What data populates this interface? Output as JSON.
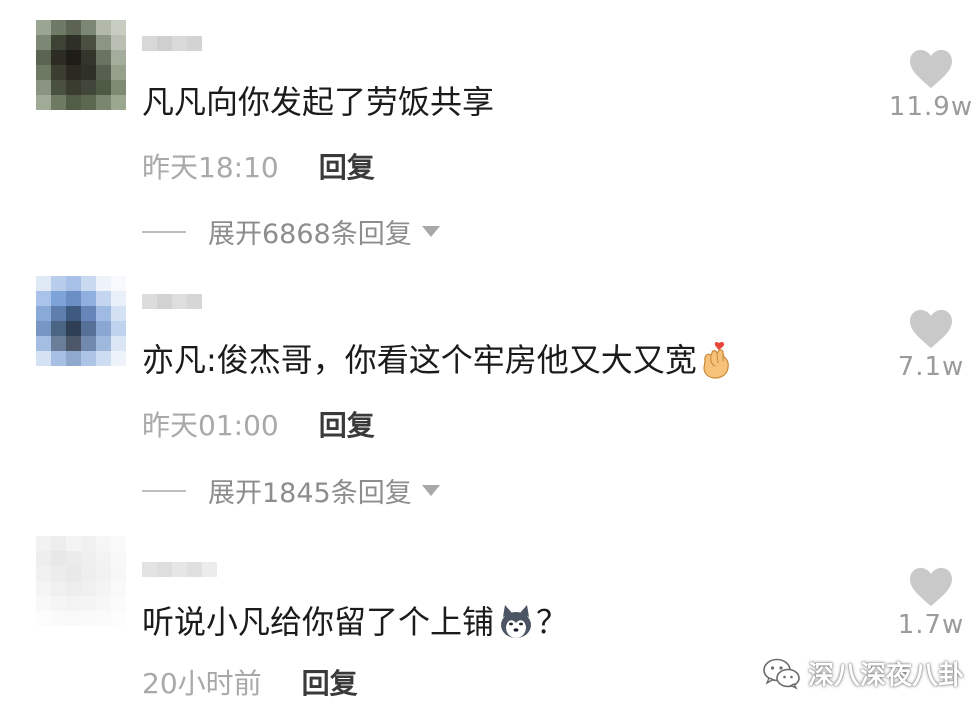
{
  "comments": [
    {
      "text": "凡凡向你发起了劳饭共享",
      "time": "昨天18:10",
      "reply_label": "回复",
      "expand_label": "展开6868条回复",
      "likes": "11.9w",
      "avatar_colors": [
        "#9aa592",
        "#6f7a66",
        "#5c6352",
        "#7b8673",
        "#b2b9aa",
        "#c8cdc2",
        "#7d8874",
        "#3c4234",
        "#2e2f27",
        "#4a5040",
        "#8c9584",
        "#b9bfb2",
        "#5a6450",
        "#2d2c24",
        "#1e1d18",
        "#34362b",
        "#6a7260",
        "#a4ac9b",
        "#6e7964",
        "#3b3d30",
        "#2a2a22",
        "#2f3128",
        "#576050",
        "#96a08b",
        "#8a9480",
        "#495040",
        "#3a3c30",
        "#41463a",
        "#4f5a45",
        "#7e8a72",
        "#a0aa96",
        "#6e7a62",
        "#525d47",
        "#5c6850",
        "#7a8670",
        "#9ca790"
      ]
    },
    {
      "text": "亦凡:俊杰哥，你看这个牢房他又大又宽",
      "emoji": "finger-heart-emoji",
      "time": "昨天01:00",
      "reply_label": "回复",
      "expand_label": "展开1845条回复",
      "likes": "7.1w",
      "avatar_colors": [
        "#dfe8f5",
        "#b8cdec",
        "#a6c0e8",
        "#c9d9f0",
        "#eef3fa",
        "#f7f9fc",
        "#a9c3ea",
        "#7ea3d8",
        "#6b8fc4",
        "#8fb0df",
        "#c4d6ef",
        "#e9f0f9",
        "#89a9d8",
        "#5e7fae",
        "#3e5a80",
        "#6685b8",
        "#9fbbe3",
        "#d4e1f3",
        "#7896c4",
        "#4a6484",
        "#2f3f56",
        "#556f96",
        "#8aa6d2",
        "#c0d3ee",
        "#a4bde2",
        "#6a7e9a",
        "#4c586a",
        "#7189ae",
        "#9fb8de",
        "#dbe6f5",
        "#d5e2f4",
        "#a7bfe2",
        "#8ea8ce",
        "#aec4e6",
        "#cddcf1",
        "#eef3fa"
      ]
    },
    {
      "text": "听说小凡给你留了个上铺",
      "emoji": "husky-emoji",
      "text_after": "？",
      "time": "20小时前",
      "reply_label": "回复",
      "likes": "1.7w",
      "avatar_colors": [
        "#f2f2f2",
        "#ededed",
        "#f4f4f4",
        "#f0f0f0",
        "#f6f6f6",
        "#fafafa",
        "#eeeeee",
        "#e8e8e8",
        "#ebebeb",
        "#efefef",
        "#f3f3f3",
        "#f8f8f8",
        "#f1f1f1",
        "#ececec",
        "#e9e9e9",
        "#eeeeee",
        "#f2f2f2",
        "#f7f7f7",
        "#f5f5f5",
        "#f0f0f0",
        "#ededed",
        "#f0f0f0",
        "#f4f4f4",
        "#f9f9f9",
        "#f8f8f8",
        "#f5f5f5",
        "#f3f3f3",
        "#f4f4f4",
        "#f7f7f7",
        "#fbfbfb",
        "#fcfcfc",
        "#fafafa",
        "#f9f9f9",
        "#fafafa",
        "#fbfbfb",
        "#fdfdfd"
      ]
    }
  ],
  "watermark": {
    "text": "深八深夜八卦",
    "icon": "wechat-icon"
  },
  "colors": {
    "like_heart": "#c9c9c9",
    "text": "#1b1b1b",
    "meta": "#a9a9a9",
    "reply": "#3a3a3a"
  }
}
